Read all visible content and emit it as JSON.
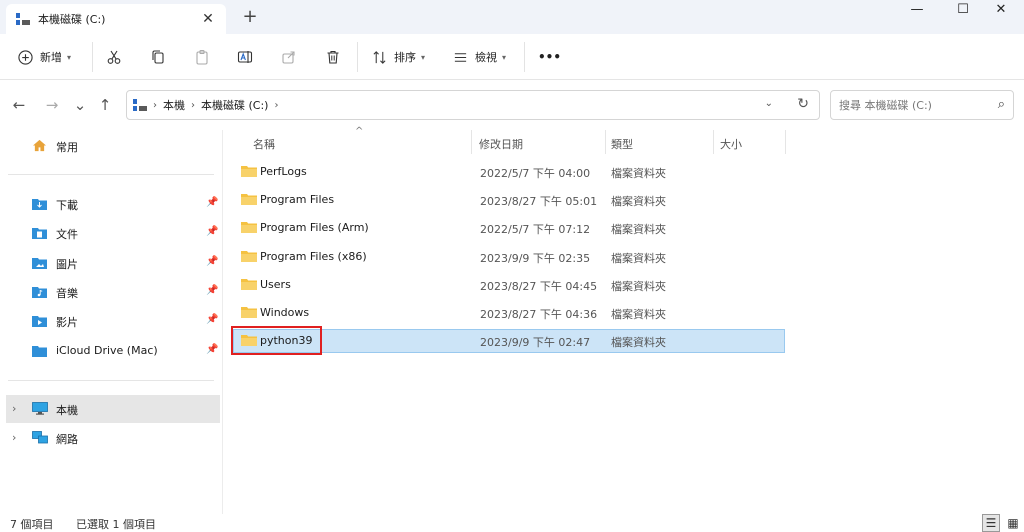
{
  "window": {
    "tab_title": "本機磁碟 (C:)",
    "tab_close": "✕",
    "new_tab": "+",
    "minimize": "—",
    "maximize": "☐",
    "close": "✕"
  },
  "toolbar": {
    "new_label": "新增",
    "sort_label": "排序",
    "view_label": "檢視",
    "more_label": "•••"
  },
  "address": {
    "crumbs": [
      "本機",
      "本機磁碟 (C:)"
    ],
    "search_placeholder": "搜尋 本機磁碟 (C:)"
  },
  "sidebar": {
    "home": "常用",
    "quick": [
      "下載",
      "文件",
      "圖片",
      "音樂",
      "影片",
      "iCloud Drive (Mac)"
    ],
    "this_pc": "本機",
    "network": "網路"
  },
  "columns": {
    "name": "名稱",
    "modified": "修改日期",
    "type": "類型",
    "size": "大小"
  },
  "files": [
    {
      "name": "PerfLogs",
      "date": "2022/5/7 下午 04:00",
      "type": "檔案資料夾"
    },
    {
      "name": "Program Files",
      "date": "2023/8/27 下午 05:01",
      "type": "檔案資料夾"
    },
    {
      "name": "Program Files (Arm)",
      "date": "2022/5/7 下午 07:12",
      "type": "檔案資料夾"
    },
    {
      "name": "Program Files (x86)",
      "date": "2023/9/9 下午 02:35",
      "type": "檔案資料夾"
    },
    {
      "name": "Users",
      "date": "2023/8/27 下午 04:45",
      "type": "檔案資料夾"
    },
    {
      "name": "Windows",
      "date": "2023/8/27 下午 04:36",
      "type": "檔案資料夾"
    },
    {
      "name": "python39",
      "date": "2023/9/9 下午 02:47",
      "type": "檔案資料夾"
    }
  ],
  "status": {
    "count": "7 個項目",
    "selected": "已選取 1 個項目"
  },
  "colors": {
    "accent": "#0067c0",
    "selection": "#cce4f7",
    "folder": "#f5c242",
    "highlight": "#e02020"
  }
}
